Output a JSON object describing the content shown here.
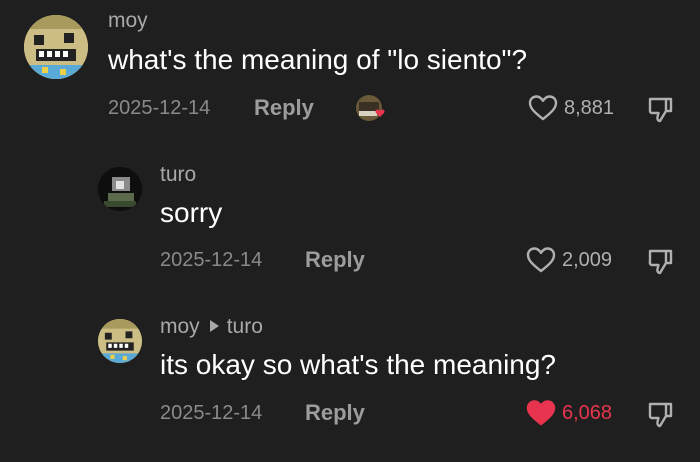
{
  "comments": [
    {
      "username": "moy",
      "text": "what's the meaning of \"lo siento\"?",
      "date": "2025-12-14",
      "reply_label": "Reply",
      "likes": "8,881",
      "liked": false
    },
    {
      "username": "turo",
      "text": "sorry",
      "date": "2025-12-14",
      "reply_label": "Reply",
      "likes": "2,009",
      "liked": false
    },
    {
      "username": "moy",
      "reply_to": "turo",
      "text": "its okay so what's the meaning?",
      "date": "2025-12-14",
      "reply_label": "Reply",
      "likes": "6,068",
      "liked": true
    }
  ],
  "icons": {
    "like": "heart-icon",
    "dislike": "thumbs-down-icon",
    "creator_like": "creator-liked-icon"
  },
  "colors": {
    "background": "#1f1f1f",
    "text": "#ffffff",
    "muted": "#a8a8a8",
    "liked": "#e8344e"
  }
}
